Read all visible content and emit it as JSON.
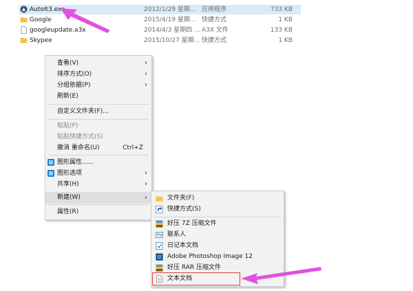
{
  "files": [
    {
      "name": "AutoIt3.exe",
      "date": "2012/1/29 星期...",
      "type": "应用程序",
      "size": "733 KB",
      "icon": "autoit-icon"
    },
    {
      "name": "Google",
      "date": "2015/4/19 星期...",
      "type": "快捷方式",
      "size": "1 KB",
      "icon": "shortcut-icon"
    },
    {
      "name": "googleupdate.a3x",
      "date": "2014/4/3 星期四 ...",
      "type": "A3X 文件",
      "size": "133 KB",
      "icon": "file-icon"
    },
    {
      "name": "Skypee",
      "date": "2015/10/27 星期...",
      "type": "快捷方式",
      "size": "1 KB",
      "icon": "shortcut-icon"
    }
  ],
  "context_menu": {
    "view": "查看(V)",
    "sort_by": "排序方式(O)",
    "group_by": "分组依据(P)",
    "refresh": "刷新(E)",
    "customize_folder": "自定义文件夹(F)...",
    "paste": "粘贴(P)",
    "paste_shortcut": "粘贴快捷方式(S)",
    "undo_rename": "撤消 重命名(U)",
    "undo_shortcut": "Ctrl+Z",
    "graphics_properties": "图形属性......",
    "graphics_options": "图形选项",
    "share": "共享(H)",
    "new": "新建(W)",
    "properties": "属性(R)"
  },
  "new_submenu": {
    "folder": "文件夹(F)",
    "shortcut": "快捷方式(S)",
    "haozip_7z": "好压 7Z 压缩文件",
    "contact": "联系人",
    "journal": "日记本文档",
    "photoshop": "Adobe Photoshop Image 12",
    "haozip_rar": "好压 RAR 压缩文件",
    "text_document": "文本文档"
  },
  "colors": {
    "annotation_arrow": "#e052e0",
    "highlight_box": "#e0393e"
  }
}
